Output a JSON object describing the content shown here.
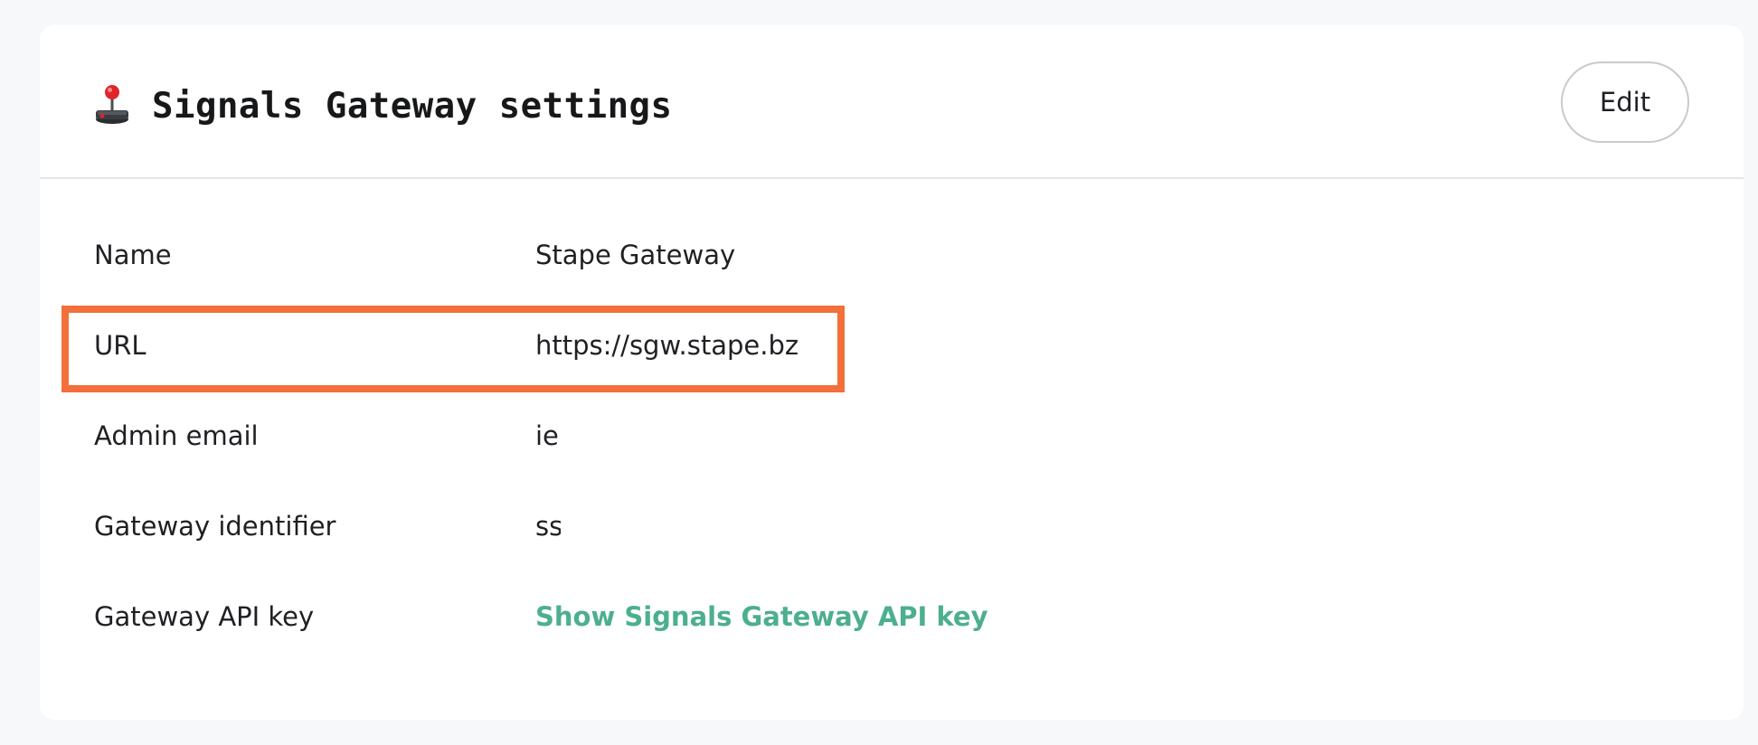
{
  "header": {
    "icon": "joystick-icon",
    "title": "Signals Gateway settings",
    "edit_label": "Edit"
  },
  "settings": {
    "name": {
      "label": "Name",
      "value": "Stape Gateway"
    },
    "url": {
      "label": "URL",
      "value": "https://sgw.stape.bz"
    },
    "admin_email": {
      "label": "Admin email",
      "value": "ie"
    },
    "gateway_identifier": {
      "label": "Gateway identifier",
      "value": "ss"
    },
    "api_key": {
      "label": "Gateway API key",
      "link_text": "Show Signals Gateway API key"
    }
  },
  "colors": {
    "highlight": "#f3703a",
    "link": "#4caf8e",
    "background": "#f7f8fa",
    "card": "#ffffff"
  }
}
